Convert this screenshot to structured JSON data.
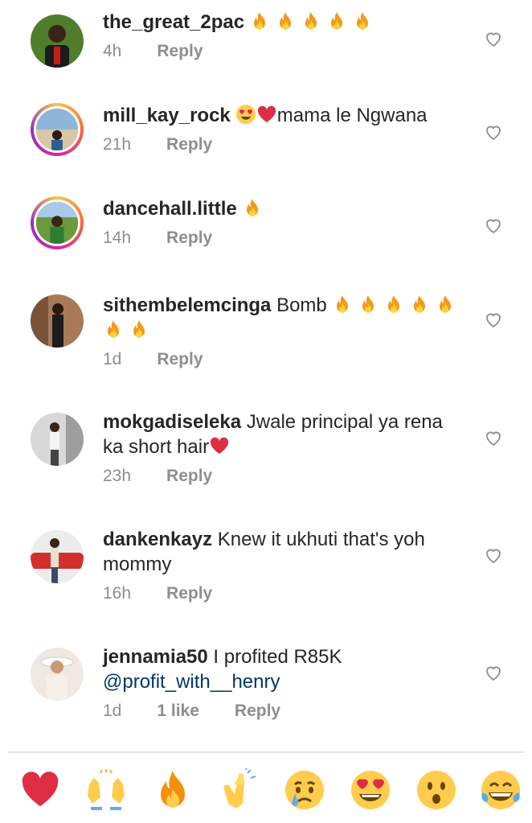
{
  "comments": [
    {
      "username": "the_great_2pac",
      "text": "",
      "emojis": [
        "fire",
        "fire",
        "fire",
        "fire",
        "fire"
      ],
      "time": "4h",
      "likes": "",
      "reply": "Reply",
      "avatar_ring": false
    },
    {
      "username": "mill_kay_rock",
      "text": "mama le Ngwana",
      "emojis_before": [
        "heart-eyes",
        "red-heart"
      ],
      "time": "21h",
      "likes": "",
      "reply": "Reply",
      "avatar_ring": true
    },
    {
      "username": "dancehall.little",
      "text": "",
      "emojis": [
        "fire"
      ],
      "time": "14h",
      "likes": "",
      "reply": "Reply",
      "avatar_ring": true
    },
    {
      "username": "sithembelemcinga",
      "text": "Bomb",
      "emojis": [
        "fire",
        "fire",
        "fire",
        "fire",
        "fire",
        "fire",
        "fire"
      ],
      "time": "1d",
      "likes": "",
      "reply": "Reply",
      "avatar_ring": false
    },
    {
      "username": "mokgadiseleka",
      "text": "Jwale principal ya rena ka short hair",
      "emojis": [
        "red-heart"
      ],
      "time": "23h",
      "likes": "",
      "reply": "Reply",
      "avatar_ring": false
    },
    {
      "username": "dankenkayz",
      "text": "Knew it ukhuti that's yoh mommy",
      "emojis": [],
      "time": "16h",
      "likes": "",
      "reply": "Reply",
      "avatar_ring": false
    },
    {
      "username": "jennamia50",
      "text": "I profited R85K",
      "mention": "@profit_with__henry",
      "emojis": [],
      "time": "1d",
      "likes": "1 like",
      "reply": "Reply",
      "avatar_ring": false
    }
  ],
  "reactions": [
    "red-heart",
    "raising-hands",
    "fire",
    "clapping-hands",
    "crying-face",
    "heart-eyes",
    "astonished-face",
    "tears-of-joy"
  ],
  "colors": {
    "text": "#262626",
    "meta": "#8e8e8e",
    "mention": "#00376b",
    "heart": "#e0245e"
  }
}
